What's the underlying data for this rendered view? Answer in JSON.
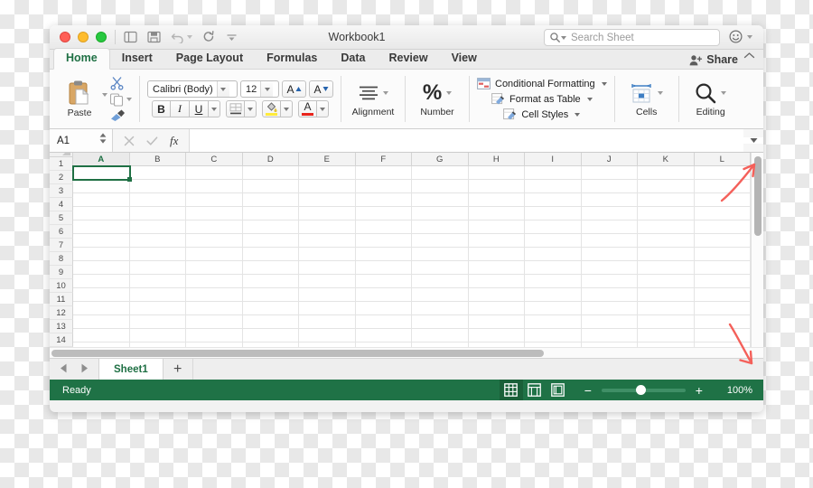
{
  "window": {
    "title": "Workbook1",
    "traffic_lights": [
      "close",
      "minimize",
      "zoom"
    ],
    "quick_access": [
      "sidebar-toggle",
      "save",
      "undo",
      "redo",
      "customize"
    ]
  },
  "search": {
    "placeholder": "Search Sheet",
    "value": ""
  },
  "account": {
    "icon": "smiley-face-icon"
  },
  "ribbon": {
    "tabs": [
      {
        "label": "Home",
        "active": true
      },
      {
        "label": "Insert",
        "active": false
      },
      {
        "label": "Page Layout",
        "active": false
      },
      {
        "label": "Formulas",
        "active": false
      },
      {
        "label": "Data",
        "active": false
      },
      {
        "label": "Review",
        "active": false
      },
      {
        "label": "View",
        "active": false
      }
    ],
    "share_label": "Share",
    "clipboard": {
      "paste_label": "Paste",
      "cut_label": "Cut",
      "copy_label": "Copy",
      "format_painter_label": "Format Painter"
    },
    "font": {
      "name": "Calibri (Body)",
      "size": "12",
      "grow_label": "A",
      "shrink_label": "A",
      "bold_label": "B",
      "italic_label": "I",
      "underline_label": "U",
      "font_color_label": "A",
      "fill_color": "#FFEB3B",
      "font_color": "#E8241C"
    },
    "alignment": {
      "label": "Alignment"
    },
    "number": {
      "label": "Number",
      "symbol": "%"
    },
    "styles": [
      {
        "label": "Conditional Formatting",
        "icon": "conditional-formatting-icon"
      },
      {
        "label": "Format as Table",
        "icon": "format-as-table-icon"
      },
      {
        "label": "Cell Styles",
        "icon": "cell-styles-icon"
      }
    ],
    "cells": {
      "label": "Cells"
    },
    "editing": {
      "label": "Editing"
    }
  },
  "formula_bar": {
    "name_box": "A1",
    "cancel_icon": "cancel-icon",
    "confirm_icon": "checkmark-icon",
    "function_icon": "fx",
    "value": ""
  },
  "grid": {
    "columns": [
      "A",
      "B",
      "C",
      "D",
      "E",
      "F",
      "G",
      "H",
      "I",
      "J",
      "K",
      "L"
    ],
    "rows": [
      "1",
      "2",
      "3",
      "4",
      "5",
      "6",
      "7",
      "8",
      "9",
      "10",
      "11",
      "12",
      "13",
      "14"
    ],
    "active_cell": "A1",
    "selection_color": "#1F7044"
  },
  "sheets": {
    "tabs": [
      "Sheet1"
    ],
    "active": "Sheet1",
    "add_label": "+",
    "prev_label": "◀",
    "next_label": "▶"
  },
  "status_bar": {
    "text": "Ready",
    "views": [
      "normal-view-icon",
      "page-layout-view-icon",
      "page-break-view-icon"
    ],
    "active_view": "normal-view-icon",
    "zoom_out": "−",
    "zoom_in": "+",
    "zoom_level": "100%",
    "accent_color": "#1F7246"
  },
  "annotations": {
    "arrow_color": "#F4605A",
    "arrows": [
      {
        "name": "arrow-to-vertical-scrollbar-top",
        "direction": "up-right"
      },
      {
        "name": "arrow-to-vertical-scrollbar-bottom",
        "direction": "down-right"
      }
    ]
  }
}
